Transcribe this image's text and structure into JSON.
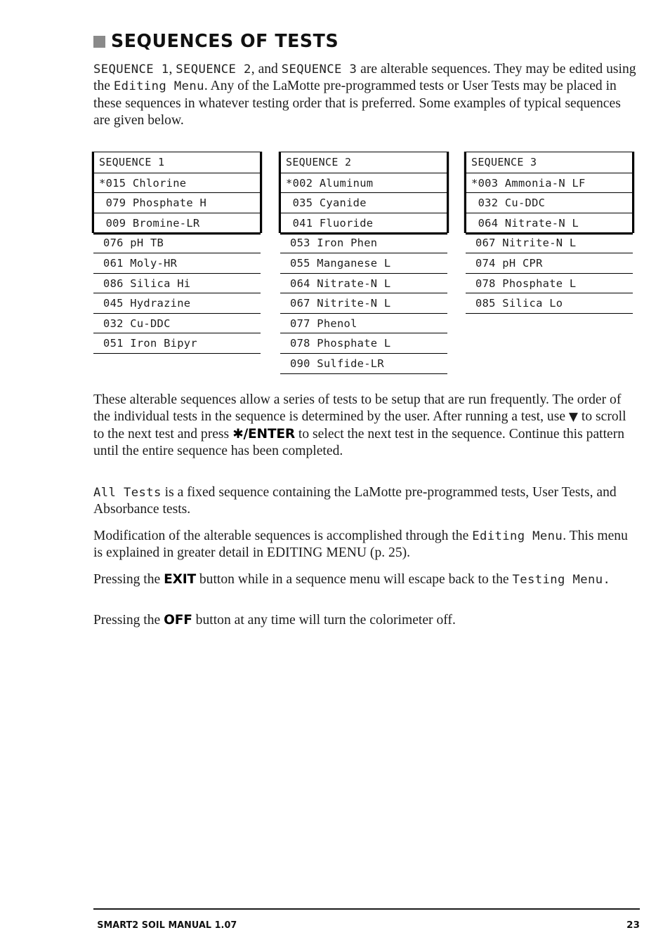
{
  "heading": {
    "bullet_color": "#8a8a8a",
    "title": "SEQUENCES OF TESTS"
  },
  "paragraphs": {
    "intro": {
      "lcd_1": "SEQUENCE 1",
      "sep_1": ", ",
      "lcd_2": "SEQUENCE 2",
      "sep_2": ", and ",
      "lcd_3": "SEQUENCE 3",
      "text_1": " are alterable sequences. They may be edited using the ",
      "lcd_4": "Editing Menu",
      "text_2": ". Any of the LaMotte pre-programmed tests or User Tests may be placed in these sequences in whatever testing order that is preferred. Some examples of typical sequences are given below."
    },
    "after_tables": {
      "text_1": "These alterable sequences allow a series of tests to be setup that are run frequently. The order of the individual tests in the sequence is determined by the user. After running a test, use ",
      "symbol_down": "▼",
      "text_2": " to scroll to the next test and press ",
      "kbd_enter": "✱/ENTER",
      "text_3": " to select the next test in the sequence. Continue this pattern until the entire sequence has been completed."
    },
    "all_tests": {
      "lcd_1": "All Tests",
      "text_1": " is a fixed sequence containing the LaMotte pre-programmed tests, User Tests, and Absorbance tests."
    },
    "modification": {
      "text_1": "Modification of the alterable sequences is accomplished through the ",
      "lcd_1": "Editing Menu",
      "text_2": ".  This menu is explained in greater  detail in EDITING MENU (p. 25)."
    },
    "exit": {
      "text_1": "Pressing the ",
      "kbd_1": "EXIT",
      "text_2": " button while in a sequence menu will escape back to the ",
      "lcd_1": "Testing Menu."
    },
    "off": {
      "text_1": "Pressing the ",
      "kbd_1": "OFF",
      "text_2": " button at any time will turn the colorimeter off."
    }
  },
  "sequences": [
    {
      "header": "SEQUENCE 1",
      "boxed_rows": [
        "*015 Chlorine",
        " 079 Phosphate H",
        " 009 Bromine-LR"
      ],
      "rest_rows": [
        "076 pH TB",
        "061 Moly-HR",
        "086 Silica Hi",
        "045 Hydrazine",
        "032 Cu-DDC",
        "051 Iron Bipyr"
      ]
    },
    {
      "header": "SEQUENCE 2",
      "boxed_rows": [
        "*002 Aluminum",
        " 035 Cyanide",
        " 041 Fluoride"
      ],
      "rest_rows": [
        "053 Iron Phen",
        "055 Manganese L",
        "064 Nitrate-N L",
        "067 Nitrite-N L",
        "077 Phenol",
        "078 Phosphate L",
        "090 Sulfide-LR"
      ]
    },
    {
      "header": "SEQUENCE 3",
      "boxed_rows": [
        "*003 Ammonia-N LF",
        " 032 Cu-DDC",
        " 064 Nitrate-N L"
      ],
      "rest_rows": [
        "067 Nitrite-N L",
        "074 pH CPR",
        "078 Phosphate L",
        "085 Silica Lo"
      ]
    }
  ],
  "footer": {
    "manual": "SMART2 SOIL MANUAL 1.07",
    "page_number": "23"
  }
}
